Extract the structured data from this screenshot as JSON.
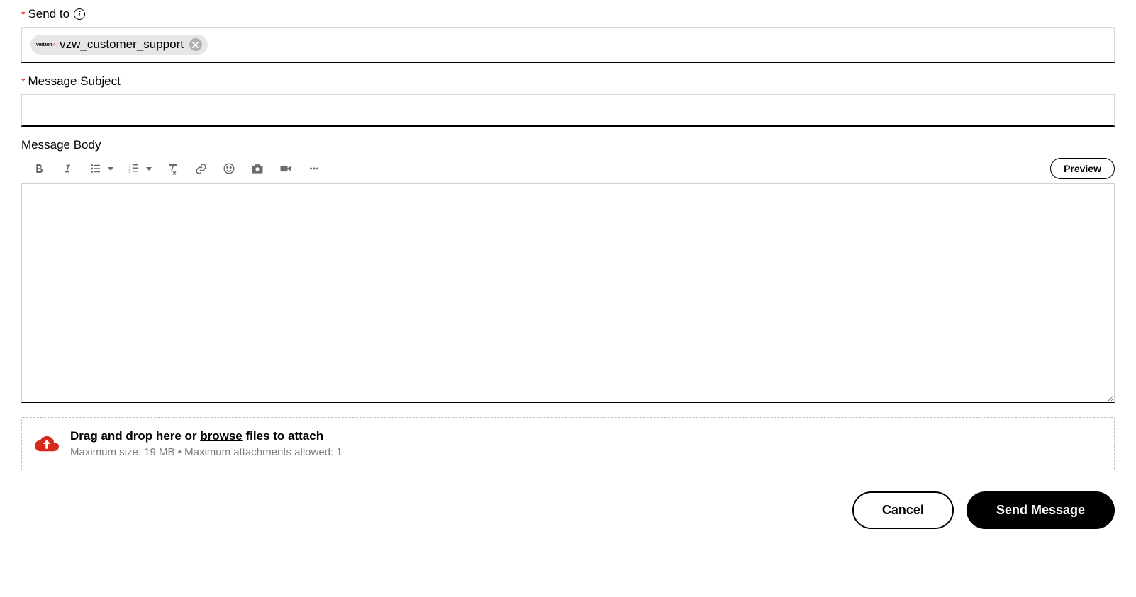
{
  "sendTo": {
    "label": "Send to",
    "recipient": {
      "avatarText": "verizon",
      "name": "vzw_customer_support"
    }
  },
  "subject": {
    "label": "Message Subject",
    "value": ""
  },
  "body": {
    "label": "Message Body",
    "previewLabel": "Preview",
    "content": ""
  },
  "attach": {
    "prefix": "Drag and drop here or ",
    "browse": "browse",
    "suffix": " files to attach",
    "limits": "Maximum size: 19 MB • Maximum attachments allowed: 1"
  },
  "actions": {
    "cancel": "Cancel",
    "send": "Send Message"
  }
}
